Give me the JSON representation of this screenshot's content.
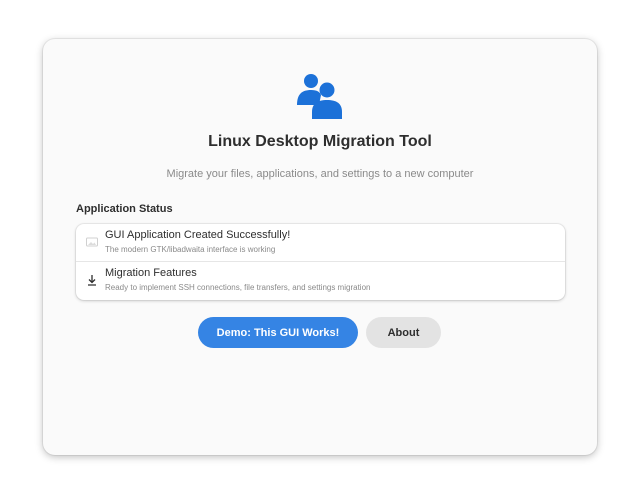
{
  "app": {
    "title": "Linux Desktop Migration Tool",
    "subtitle": "Migrate your files, applications, and settings to a new computer",
    "hero_icon": "users-icon"
  },
  "status": {
    "heading": "Application Status",
    "items": [
      {
        "icon": "image-placeholder-icon",
        "title": "GUI Application Created Successfully!",
        "subtitle": "The modern GTK/libadwaita interface is working"
      },
      {
        "icon": "download-icon",
        "title": "Migration Features",
        "subtitle": "Ready to implement SSH connections, file transfers, and settings migration"
      }
    ]
  },
  "actions": {
    "demo_label": "Demo: This GUI Works!",
    "about_label": "About"
  },
  "colors": {
    "accent": "#3584e4",
    "hero_icon": "#1c71d8",
    "window_bg": "#fafafa",
    "secondary_button": "#e3e3e3"
  }
}
